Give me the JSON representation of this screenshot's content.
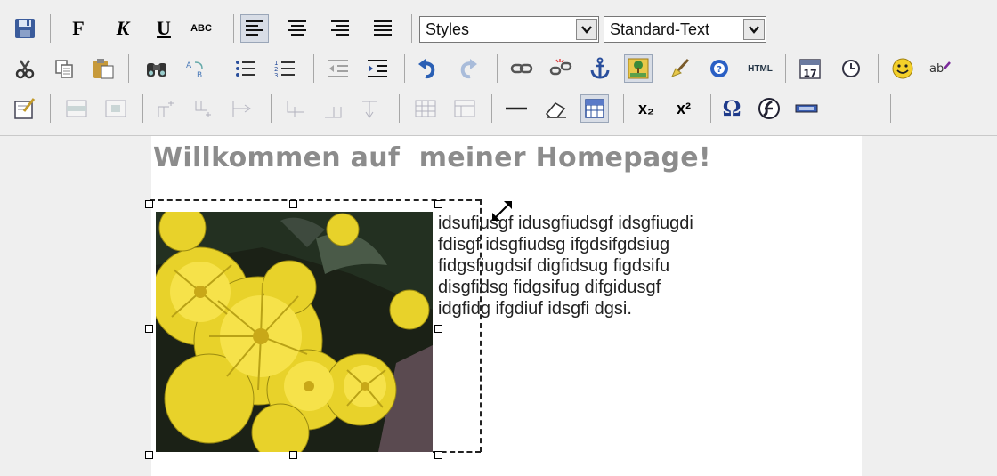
{
  "editor": {
    "toolbar": {
      "format_buttons": {
        "bold_label": "F",
        "italic_label": "K",
        "underline_label": "U",
        "strike_label": "ABC"
      },
      "styles_select": {
        "value": "Styles"
      },
      "format_select": {
        "value": "Standard-Text"
      },
      "html_label": "HTML",
      "omega_label": "Ω",
      "sub_label": "x₂",
      "sup_label": "x²",
      "calendar_label": "17"
    },
    "content": {
      "heading": "Willkommen auf  meiner Homepage!",
      "paragraph_lines": [
        "idsufiusgf idusgfiudsgf idsgfiugdi",
        "fdisgf idsgfiudsg ifgdsifgdsiug",
        "fidgsfiugdsif digfidsug figdsifu",
        "disgfidsg fidgsifug difgidusgf",
        "idgfidg ifgdiuf idsgfi dgsi."
      ]
    }
  },
  "colors": {
    "toolbar_bg": "#efefef",
    "page_bg": "#ffffff",
    "heading": "#8c8c8c",
    "flower_yellow": "#e8d22a"
  }
}
